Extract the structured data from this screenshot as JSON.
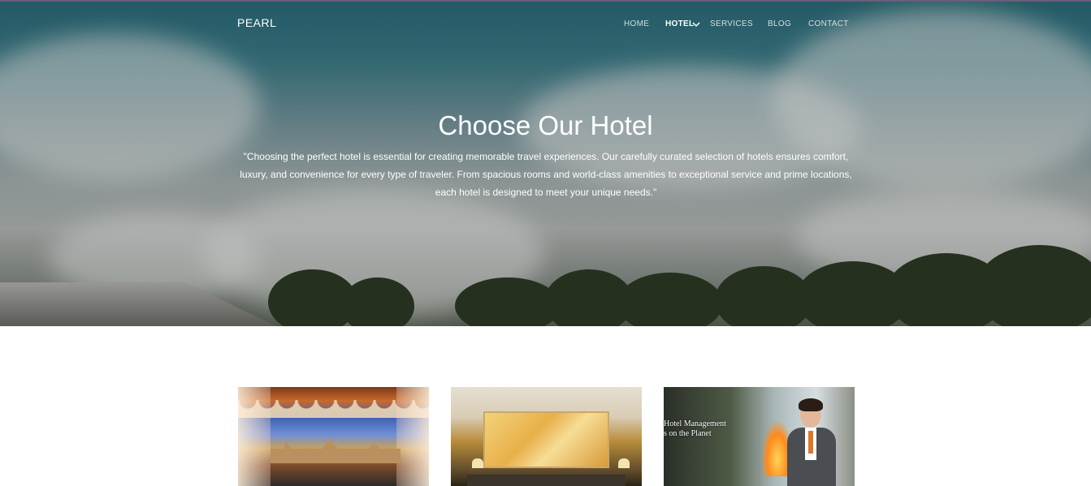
{
  "brand": "PEARL",
  "nav": {
    "items": [
      {
        "label": "HOME"
      },
      {
        "label": "HOTEL"
      },
      {
        "label": "SERVICES"
      },
      {
        "label": "BLOG"
      },
      {
        "label": "CONTACT"
      }
    ],
    "active": "HOTEL",
    "dropdown_icon": "chevron-down-icon"
  },
  "hero": {
    "title": "Choose Our Hotel",
    "text": "\"Choosing the perfect hotel is essential for creating memorable travel experiences. Our carefully curated selection of hotels ensures comfort, luxury, and convenience for every type of traveler. From spacious rooms and world-class amenities to exceptional service and prime locations, each hotel is designed to meet your unique needs.\""
  },
  "cards": [
    {
      "image": "palace-view-through-curtains"
    },
    {
      "image": "hotel-lobby-reception"
    },
    {
      "image": "hotel-staff-flambe",
      "sign_line1": "Hotel Management",
      "sign_line2": "s on the Planet"
    }
  ],
  "colors": {
    "nav_text": "#d5dee0",
    "nav_active": "#ffffff",
    "hero_text": "#ffffff",
    "page_bg": "#ffffff"
  }
}
